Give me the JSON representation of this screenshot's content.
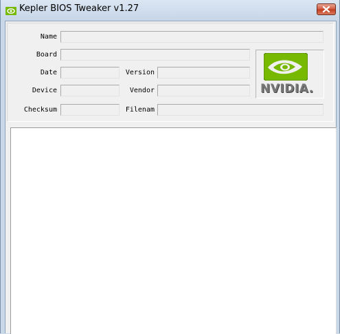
{
  "window": {
    "title": "Kepler BIOS Tweaker v1.27",
    "icon": "nvidia-app-icon",
    "close_icon": "close-icon"
  },
  "fields": {
    "name": {
      "label": "Name",
      "value": ""
    },
    "board": {
      "label": "Board",
      "value": ""
    },
    "date": {
      "label": "Date",
      "value": ""
    },
    "version": {
      "label": "Version",
      "value": ""
    },
    "device": {
      "label": "Device",
      "value": ""
    },
    "vendor": {
      "label": "Vendor",
      "value": ""
    },
    "checksum": {
      "label": "Checksum",
      "value": ""
    },
    "filename": {
      "label": "Filenam",
      "value": ""
    }
  },
  "logo": {
    "text": "NVIDIA.",
    "icon": "nvidia-eye-icon",
    "brand_color": "#76b900"
  },
  "output": {
    "text": ""
  }
}
